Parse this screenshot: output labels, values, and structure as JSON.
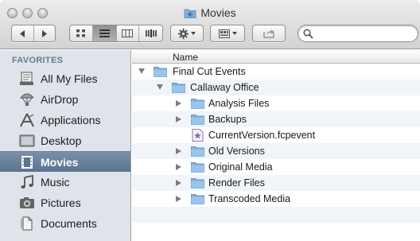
{
  "window": {
    "title": "Movies"
  },
  "toolbar": {
    "back_icon": "chevron-left-icon",
    "forward_icon": "chevron-right-icon",
    "views": [
      {
        "name": "icon-view",
        "icon": "grid-icon"
      },
      {
        "name": "list-view",
        "icon": "list-icon",
        "active": true
      },
      {
        "name": "column-view",
        "icon": "columns-icon"
      },
      {
        "name": "coverflow-view",
        "icon": "coverflow-icon"
      }
    ],
    "action_icon": "gear-icon",
    "arrange_icon": "arrange-icon",
    "share_icon": "share-icon",
    "search_icon": "search-icon",
    "search_placeholder": ""
  },
  "sidebar": {
    "heading": "FAVORITES",
    "items": [
      {
        "label": "All My Files",
        "icon": "all-files-icon"
      },
      {
        "label": "AirDrop",
        "icon": "airdrop-icon"
      },
      {
        "label": "Applications",
        "icon": "applications-icon"
      },
      {
        "label": "Desktop",
        "icon": "desktop-icon"
      },
      {
        "label": "Movies",
        "icon": "movies-icon",
        "selected": true
      },
      {
        "label": "Music",
        "icon": "music-icon"
      },
      {
        "label": "Pictures",
        "icon": "pictures-icon"
      },
      {
        "label": "Documents",
        "icon": "documents-icon"
      }
    ]
  },
  "list": {
    "column_name": "Name",
    "rows": [
      {
        "label": "Final Cut Events",
        "depth": 0,
        "expanded": true,
        "kind": "folder"
      },
      {
        "label": "Callaway Office",
        "depth": 1,
        "expanded": true,
        "kind": "folder"
      },
      {
        "label": "Analysis Files",
        "depth": 2,
        "expanded": false,
        "kind": "folder"
      },
      {
        "label": "Backups",
        "depth": 2,
        "expanded": false,
        "kind": "folder"
      },
      {
        "label": "CurrentVersion.fcpevent",
        "depth": 2,
        "expanded": null,
        "kind": "file"
      },
      {
        "label": "Old Versions",
        "depth": 2,
        "expanded": false,
        "kind": "folder"
      },
      {
        "label": "Original Media",
        "depth": 2,
        "expanded": false,
        "kind": "folder"
      },
      {
        "label": "Render Files",
        "depth": 2,
        "expanded": false,
        "kind": "folder"
      },
      {
        "label": "Transcoded Media",
        "depth": 2,
        "expanded": false,
        "kind": "folder"
      }
    ]
  },
  "colors": {
    "folder_blue": "#7fb1dc",
    "selection": "#5b7391",
    "sidebar_bg": "#dee4ea",
    "row_alt": "#f1f4f8"
  }
}
